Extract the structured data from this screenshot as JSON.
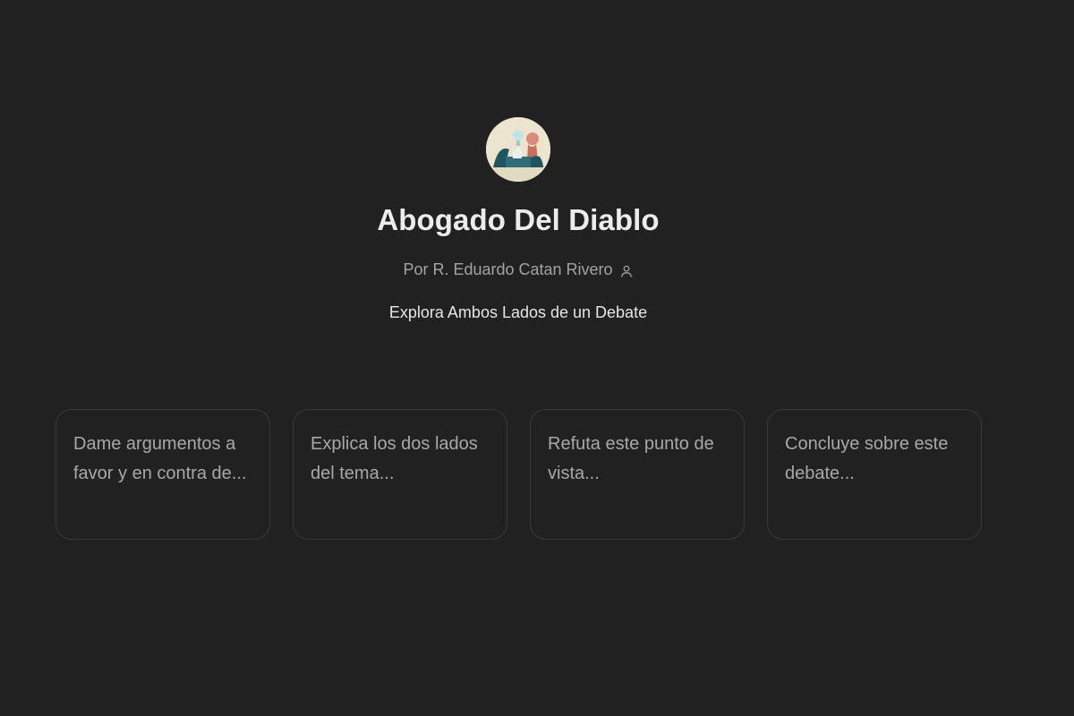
{
  "gpt": {
    "title": "Abogado Del Diablo",
    "author_prefix": "Por",
    "author_name": "R. Eduardo Catan Rivero",
    "author_icon": "person-icon",
    "tagline": "Explora Ambos Lados de un Debate",
    "avatar_icon": "gpt-avatar"
  },
  "conversation_starters": [
    {
      "text": "Dame argumentos a favor y en contra de..."
    },
    {
      "text": "Explica los dos lados del tema..."
    },
    {
      "text": "Refuta este punto de vista..."
    },
    {
      "text": "Concluye sobre este debate..."
    }
  ],
  "colors": {
    "background": "#212121",
    "title": "#ececec",
    "muted_text": "#a3a3a3",
    "card_border": "#3a3a3a"
  }
}
